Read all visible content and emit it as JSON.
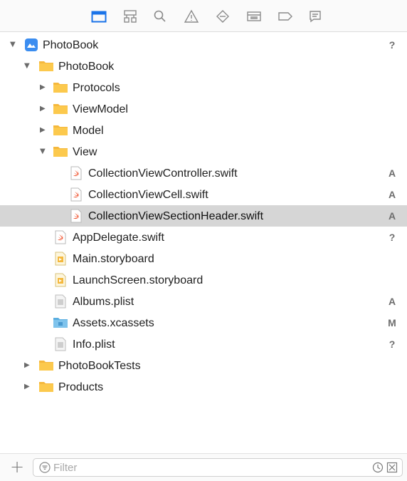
{
  "navigator_tabs": [
    {
      "icon": "folder-icon",
      "active": true
    },
    {
      "icon": "hierarchy-icon",
      "active": false
    },
    {
      "icon": "search-icon",
      "active": false
    },
    {
      "icon": "warning-icon",
      "active": false
    },
    {
      "icon": "diamond-icon",
      "active": false
    },
    {
      "icon": "debug-icon",
      "active": false
    },
    {
      "icon": "breakpoint-icon",
      "active": false
    },
    {
      "icon": "report-icon",
      "active": false
    }
  ],
  "colors": {
    "accent": "#1a73e8",
    "folder": "#f5b83d",
    "selected_row": "#d6d6d6",
    "status": "#6e6e6e"
  },
  "tree": [
    {
      "label": "PhotoBook",
      "icon": "project-icon",
      "disclosure": "open",
      "status": "?"
    },
    {
      "label": "PhotoBook",
      "icon": "folder-icon",
      "disclosure": "open",
      "status": ""
    },
    {
      "label": "Protocols",
      "icon": "folder-icon",
      "disclosure": "closed",
      "status": ""
    },
    {
      "label": "ViewModel",
      "icon": "folder-icon",
      "disclosure": "closed",
      "status": ""
    },
    {
      "label": "Model",
      "icon": "folder-icon",
      "disclosure": "closed",
      "status": ""
    },
    {
      "label": "View",
      "icon": "folder-icon",
      "disclosure": "open",
      "status": ""
    },
    {
      "label": "CollectionViewController.swift",
      "icon": "swift-file-icon",
      "disclosure": "",
      "status": "A"
    },
    {
      "label": "CollectionViewCell.swift",
      "icon": "swift-file-icon",
      "disclosure": "",
      "status": "A"
    },
    {
      "label": "CollectionViewSectionHeader.swift",
      "icon": "swift-file-icon",
      "disclosure": "",
      "status": "A",
      "selected": true
    },
    {
      "label": "AppDelegate.swift",
      "icon": "swift-file-icon",
      "disclosure": "",
      "status": "?"
    },
    {
      "label": "Main.storyboard",
      "icon": "storyboard-icon",
      "disclosure": "",
      "status": ""
    },
    {
      "label": "LaunchScreen.storyboard",
      "icon": "storyboard-icon",
      "disclosure": "",
      "status": ""
    },
    {
      "label": "Albums.plist",
      "icon": "plist-icon",
      "disclosure": "",
      "status": "A"
    },
    {
      "label": "Assets.xcassets",
      "icon": "assets-folder-icon",
      "disclosure": "",
      "status": "M"
    },
    {
      "label": "Info.plist",
      "icon": "plist-icon",
      "disclosure": "",
      "status": "?"
    },
    {
      "label": "PhotoBookTests",
      "icon": "folder-icon",
      "disclosure": "closed",
      "status": ""
    },
    {
      "label": "Products",
      "icon": "folder-icon",
      "disclosure": "closed",
      "status": ""
    }
  ],
  "bottom_bar": {
    "add_label": "+",
    "filter_placeholder": "Filter",
    "filter_value": ""
  }
}
